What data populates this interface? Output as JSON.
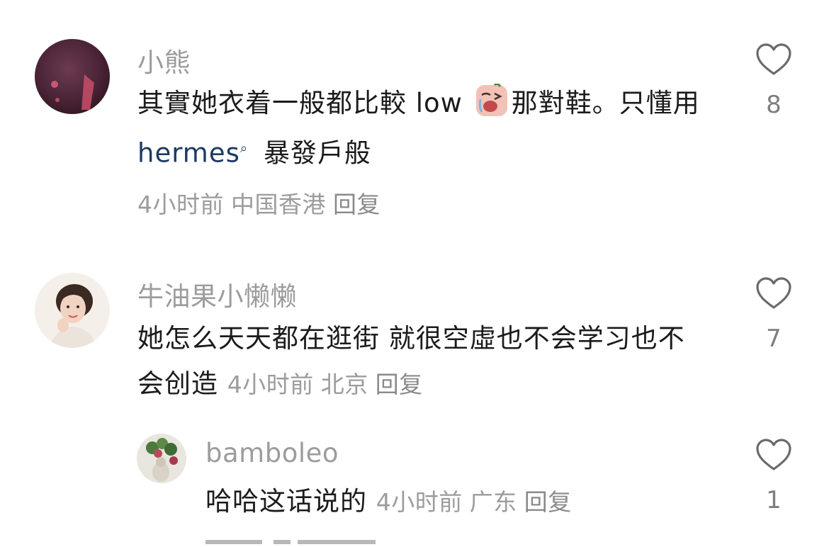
{
  "comments": [
    {
      "username": "小熊",
      "text_before": "其實她衣着一般都比較 low ",
      "emoji": "crying-face-emoji",
      "text_after": "那對鞋。只懂用 ",
      "link_text": "hermes",
      "text_end": "暴發戶般",
      "time": "4小时前",
      "location": "中国香港",
      "reply": "回复",
      "likes": "8"
    },
    {
      "username": "牛油果小懒懒",
      "text": "她怎么天天都在逛街 就很空虛也不会学习也不会创造 ",
      "time": "4小时前",
      "location": "北京",
      "reply": "回复",
      "likes": "7"
    },
    {
      "username": "bamboleo",
      "text": "哈哈这话说的 ",
      "time": "4小时前",
      "location": "广东",
      "reply": "回复",
      "likes": "1"
    }
  ],
  "colors": {
    "username": "#9c9c9c",
    "link": "#1d3a63",
    "body": "#1b1b1b"
  }
}
